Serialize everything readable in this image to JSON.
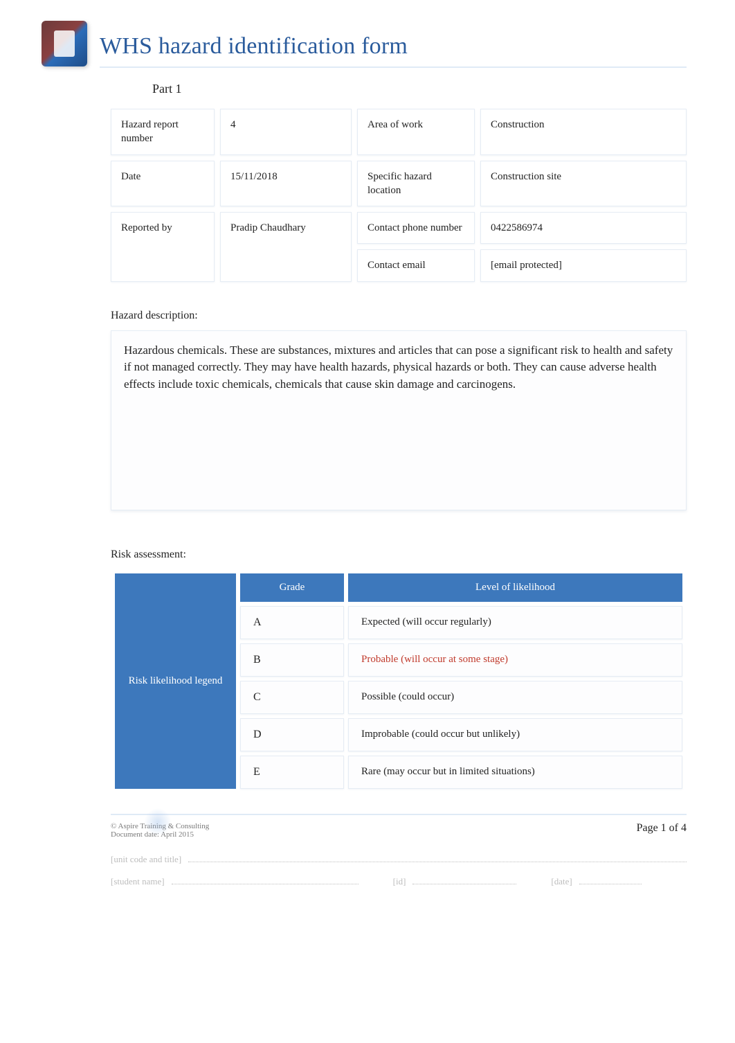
{
  "header": {
    "title": "WHS hazard identification form",
    "part_label": "Part 1"
  },
  "fields": {
    "hazard_number_label": "Hazard report number",
    "hazard_number_value": "4",
    "area_label": "Area of work",
    "area_value": "Construction",
    "date_label": "Date",
    "date_value": "15/11/2018",
    "location_label": "Specific hazard location",
    "location_value": "Construction site",
    "reported_by_label": "Reported by",
    "reported_by_value": "Pradip Chaudhary",
    "phone_label": "Contact phone number",
    "phone_value": "0422586974",
    "email_label": "Contact email",
    "email_value": "[email protected]"
  },
  "hazard_description": {
    "heading": "Hazard description:",
    "text": "Hazardous chemicals. These are substances, mixtures and articles that can pose a significant risk to health and safety if not managed correctly. They may have health hazards, physical hazards or both. They can cause adverse health effects include toxic chemicals, chemicals that cause skin damage and carcinogens."
  },
  "risk_assessment": {
    "heading": "Risk assessment:",
    "side_label": "Risk likelihood legend",
    "col_grade": "Grade",
    "col_level": "Level of likelihood",
    "rows": [
      {
        "grade": "A",
        "level": "Expected (will occur regularly)",
        "highlight": false
      },
      {
        "grade": "B",
        "level": "Probable (will occur at some stage)",
        "highlight": true
      },
      {
        "grade": "C",
        "level": "Possible (could occur)",
        "highlight": false
      },
      {
        "grade": "D",
        "level": "Improbable (could occur but unlikely)",
        "highlight": false
      },
      {
        "grade": "E",
        "level": "Rare (may occur but in limited situations)",
        "highlight": false
      }
    ]
  },
  "footer": {
    "copyright": "© Aspire Training & Consulting",
    "doc_date": "Document date:   April 2015",
    "page": "Page 1 of 4",
    "unit_label": "[unit code and title]",
    "student_label": "[student name]",
    "id_label": "[id]",
    "date_label": "[date]"
  }
}
